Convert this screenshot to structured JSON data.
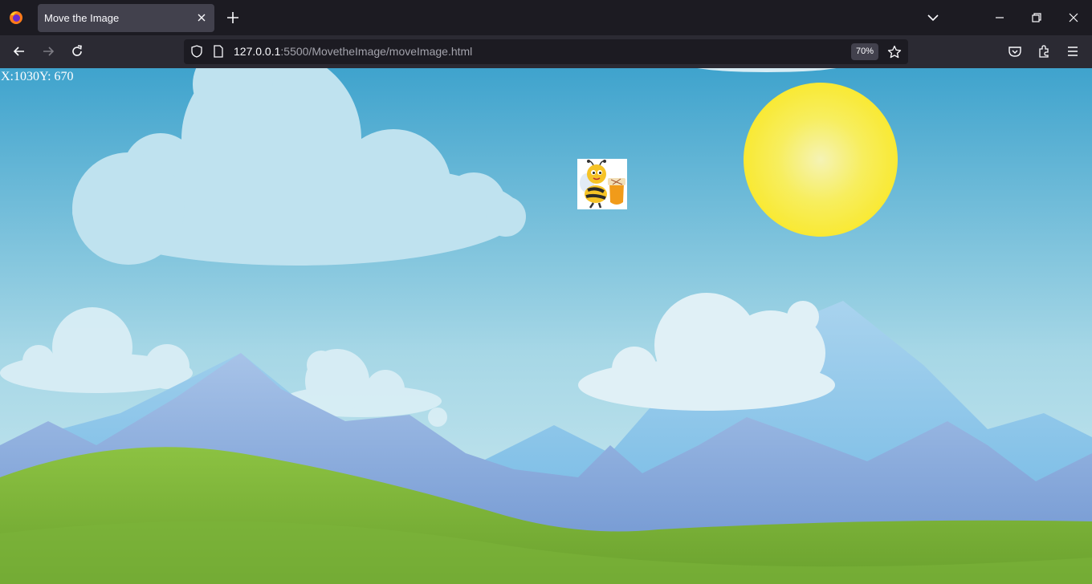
{
  "browser": {
    "tab": {
      "title": "Move the Image"
    },
    "url": {
      "host": "127.0.0.1",
      "rest": ":5500/MovetheImage/moveImage.html"
    },
    "zoom": "70%"
  },
  "page": {
    "x_label": "X:",
    "x_value": "1030",
    "y_label": "Y: ",
    "y_value": "670",
    "image": {
      "name": "bee with honey jar"
    }
  },
  "icons": [
    "firefox-icon",
    "close-icon",
    "plus-icon",
    "chevron-down-icon",
    "minimize-icon",
    "restore-icon",
    "back-icon",
    "forward-icon",
    "reload-icon",
    "shield-icon",
    "page-icon",
    "star-icon",
    "pocket-icon",
    "extensions-icon",
    "menu-icon"
  ],
  "colors": {
    "sky_top": "#3fa3cd",
    "sky_bottom": "#c4e6ee",
    "sun": "#f8ea3b",
    "grass": "#7ab23a",
    "mountain": "#8ea6d6"
  }
}
